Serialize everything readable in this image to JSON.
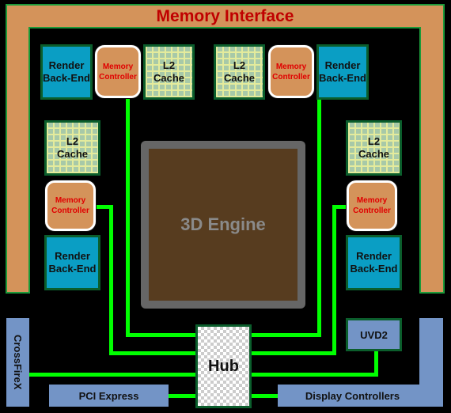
{
  "title": "Memory Interface",
  "blocks": {
    "render_backend": "Render Back-End",
    "memory_controller": "Memory Controller",
    "l2_cache": "L2 Cache",
    "engine": "3D Engine",
    "hub": "Hub",
    "uvd": "UVD2",
    "crossfire": "CrossFireX",
    "pci": "PCI Express",
    "display": "Display Controllers"
  },
  "labels": {
    "rbe_line1": "Render",
    "rbe_line2": "Back-End",
    "mc_line1": "Memory",
    "mc_line2": "Controller",
    "l2_line1": "L2",
    "l2_line2": "Cache"
  },
  "colors": {
    "memory_interface": "#d4935a",
    "render_backend": "#0a9ec4",
    "l2_cache": "#a7c9a8",
    "engine": "#573c1f",
    "io": "#7394c6",
    "bus": "#00ff00",
    "title_text": "#c00000"
  }
}
